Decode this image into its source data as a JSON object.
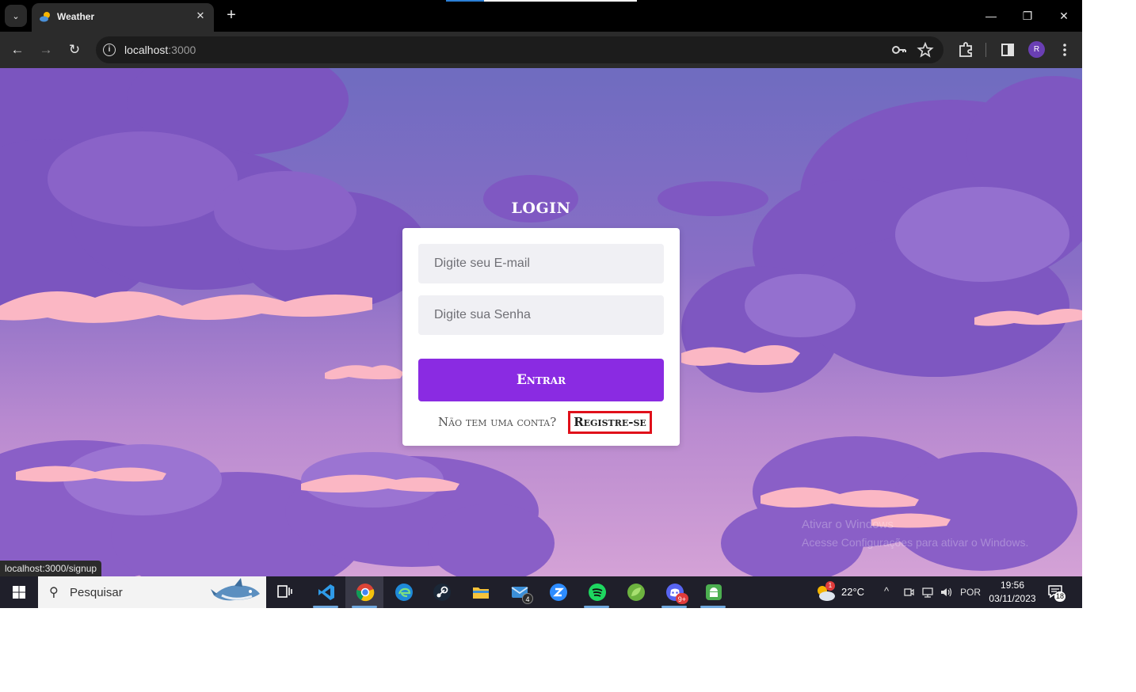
{
  "browser": {
    "tab_title": "Weather",
    "tab_close": "✕",
    "new_tab": "+",
    "tab_search": "⌄",
    "url_host": "localhost",
    "url_port": ":3000",
    "back": "←",
    "forward": "→",
    "reload": "↻",
    "profile_initial": "R",
    "minimize": "—",
    "restore": "❐",
    "close": "✕",
    "icons": [
      "tab-search-icon",
      "weather-favicon-icon",
      "close-icon",
      "plus-icon",
      "back-arrow-icon",
      "forward-arrow-icon",
      "reload-icon",
      "site-info-icon",
      "password-key-icon",
      "bookmark-star-icon",
      "extensions-icon",
      "side-panel-icon",
      "kebab-menu-icon"
    ]
  },
  "login": {
    "title": "LOGIN",
    "email_placeholder": "Digite seu E-mail",
    "password_placeholder": "Digite sua Senha",
    "submit_label": "Entrar",
    "signup_prompt": "Não tem uma conta?",
    "signup_link": "Registre-se",
    "colors": {
      "button": "#8a2be2",
      "card": "#ffffff",
      "field": "#f0f0f4",
      "highlight": "#e0101a"
    }
  },
  "status_bar": {
    "url": "localhost:3000/signup"
  },
  "watermark": {
    "line1": "Ativar o Windows",
    "line2": "Acesse Configurações para ativar o Windows."
  },
  "taskbar": {
    "search_placeholder": "Pesquisar",
    "apps": [
      {
        "name": "task-view",
        "icon": "task-view-icon"
      },
      {
        "name": "vscode",
        "icon": "vscode-icon",
        "running": true
      },
      {
        "name": "chrome",
        "icon": "chrome-icon",
        "running": true,
        "active": true
      },
      {
        "name": "edge",
        "icon": "edge-icon"
      },
      {
        "name": "steam",
        "icon": "steam-icon"
      },
      {
        "name": "file-explorer",
        "icon": "folder-icon"
      },
      {
        "name": "mail",
        "icon": "mail-icon",
        "badge": "4"
      },
      {
        "name": "zoom",
        "icon": "zoom-icon"
      },
      {
        "name": "spotify",
        "icon": "spotify-icon",
        "running": true
      },
      {
        "name": "spring-tool-suite",
        "icon": "leaf-icon"
      },
      {
        "name": "discord",
        "icon": "discord-icon",
        "running": true,
        "badge": "9+"
      },
      {
        "name": "android-studio",
        "icon": "android-icon",
        "running": true
      }
    ],
    "weather_temp": "22°C",
    "weather_alert": "1",
    "tray_chevron": "^",
    "language": "POR",
    "time": "19:56",
    "date": "03/11/2023",
    "notification_count": "18"
  }
}
